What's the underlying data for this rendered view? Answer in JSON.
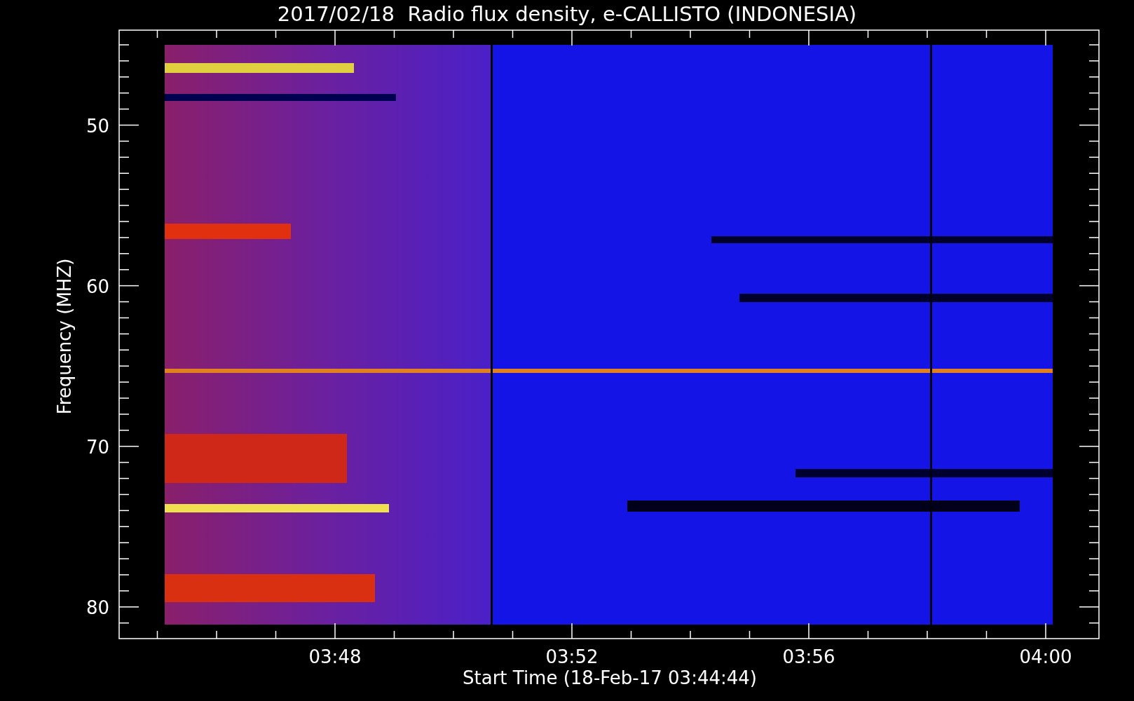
{
  "title": "2017/02/18  Radio flux density, e-CALLISTO (INDONESIA)",
  "plot": {
    "ylabel": "Frequency (MHZ)",
    "xlabel": "Start Time (18-Feb-17 03:44:44)",
    "yticks": [
      "50",
      "60",
      "70",
      "80"
    ],
    "xticks": [
      "03:48",
      "03:52",
      "03:56",
      "04:00"
    ]
  }
}
